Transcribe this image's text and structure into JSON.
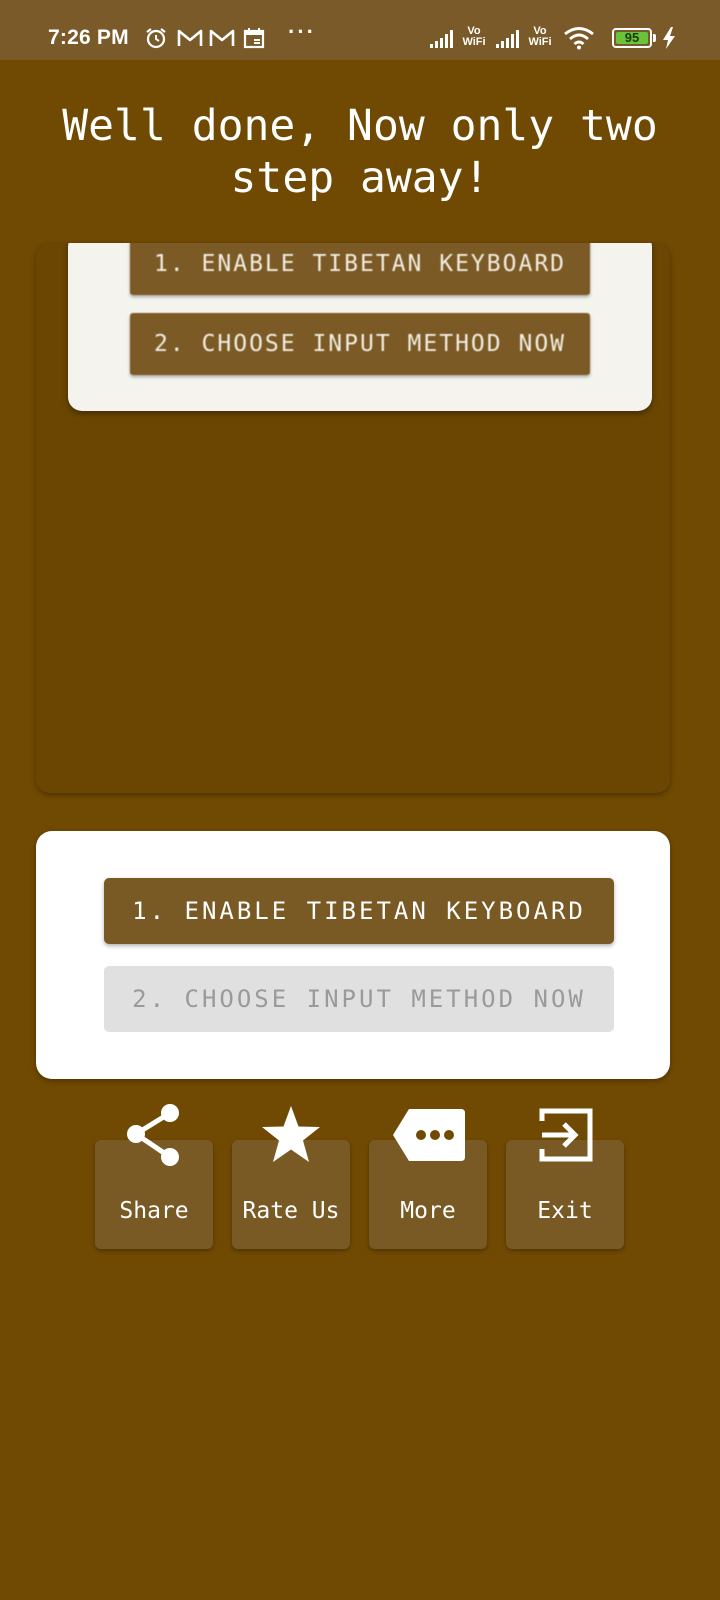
{
  "status_bar": {
    "time": "7:26 PM",
    "icons": [
      "alarm-icon",
      "gmail-icon",
      "gmail-icon",
      "calendar-icon",
      "more-dots-icon",
      "signal-icon",
      "vowifi-icon",
      "signal-icon",
      "vowifi-icon",
      "wifi-icon",
      "battery-icon",
      "charging-icon"
    ],
    "dots": "···",
    "vowifi_top": "Vo",
    "vowifi_bottom": "WiFi",
    "battery": "95"
  },
  "title": "Well done, Now only two step away!",
  "preview": {
    "step1_label": "1. ENABLE TIBETAN KEYBOARD",
    "step2_label": "2. CHOOSE INPUT METHOD NOW"
  },
  "steps": {
    "step1_label": "1. ENABLE TIBETAN KEYBOARD",
    "step2_label": "2. CHOOSE INPUT METHOD NOW"
  },
  "actions": [
    {
      "label": "Share",
      "icon": "share-icon"
    },
    {
      "label": "Rate Us",
      "icon": "star-icon"
    },
    {
      "label": "More",
      "icon": "more-tag-icon"
    },
    {
      "label": "Exit",
      "icon": "exit-icon"
    }
  ],
  "colors": {
    "background": "#704a03",
    "status_bar": "#7a5a28",
    "button_brown": "#7a5a24",
    "disabled_button": "#e0e0e0"
  }
}
